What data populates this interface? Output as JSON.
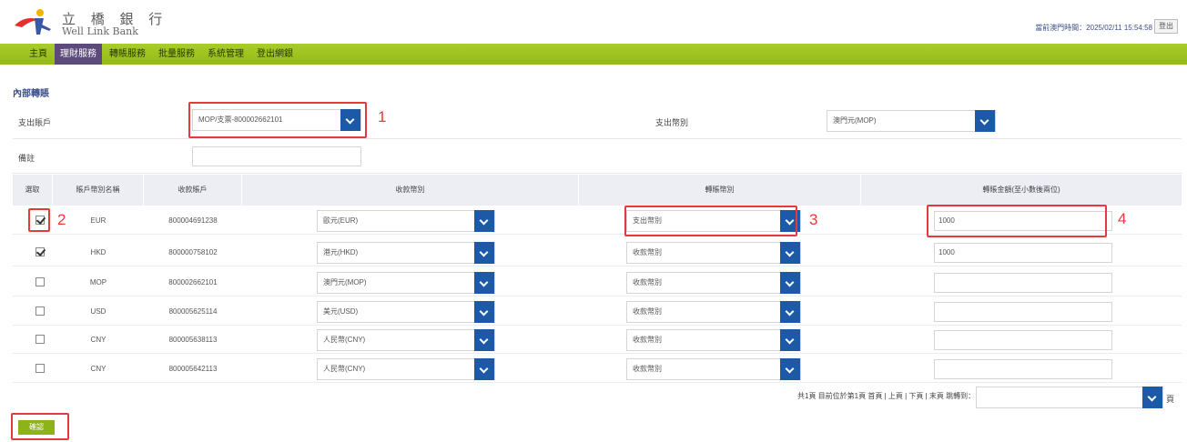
{
  "header": {
    "brand_cn": "立 橋 銀 行",
    "brand_en": "Well Link Bank",
    "login_info": "當前澳門時間：2025/02/11 15:54:58",
    "logout_label": "登出"
  },
  "nav": [
    {
      "label": "主頁"
    },
    {
      "label": "理財服務"
    },
    {
      "label": "轉賬服務"
    },
    {
      "label": "批量服務"
    },
    {
      "label": "系統管理"
    },
    {
      "label": "登出網銀"
    }
  ],
  "form": {
    "title": "內部轉賬",
    "debit_account_label": "支出賬戶",
    "debit_account_value": "MOP/支票-800002662101",
    "debit_currency_label": "支出幣別",
    "debit_currency_value": "澳門元(MOP)",
    "remark_label": "備註",
    "remark_value": ""
  },
  "table": {
    "headers": [
      "選取",
      "賬戶幣別名稱",
      "收款賬戶",
      "收款幣別",
      "轉賬幣別",
      "轉賬金額(至小數後兩位)"
    ],
    "rows": [
      {
        "checked": true,
        "currency": "EUR",
        "account": "800004691238",
        "recv_currency": "歐元(EUR)",
        "transfer_currency": "支出幣別",
        "amount": "1000"
      },
      {
        "checked": true,
        "currency": "HKD",
        "account": "800000758102",
        "recv_currency": "港元(HKD)",
        "transfer_currency": "收款幣別",
        "amount": "1000"
      },
      {
        "checked": false,
        "currency": "MOP",
        "account": "800002662101",
        "recv_currency": "澳門元(MOP)",
        "transfer_currency": "收款幣別",
        "amount": ""
      },
      {
        "checked": false,
        "currency": "USD",
        "account": "800005625114",
        "recv_currency": "美元(USD)",
        "transfer_currency": "收款幣別",
        "amount": ""
      },
      {
        "checked": false,
        "currency": "CNY",
        "account": "800005638113",
        "recv_currency": "人民幣(CNY)",
        "transfer_currency": "收款幣別",
        "amount": ""
      },
      {
        "checked": false,
        "currency": "CNY",
        "account": "800005642113",
        "recv_currency": "人民幣(CNY)",
        "transfer_currency": "收款幣別",
        "amount": ""
      }
    ]
  },
  "pager": {
    "text": "共1頁  目前位於第1頁  首頁 | 上頁 | 下頁 | 末頁  跳轉到：",
    "suffix": "頁"
  },
  "confirm_label": "確認",
  "annotations": [
    "1",
    "2",
    "3",
    "4"
  ],
  "colors": {
    "nav_green": "#9bc31c",
    "accent_blue": "#1c5aa8",
    "highlight_red": "#e23b3b",
    "active_tab": "#5b4a7a"
  }
}
